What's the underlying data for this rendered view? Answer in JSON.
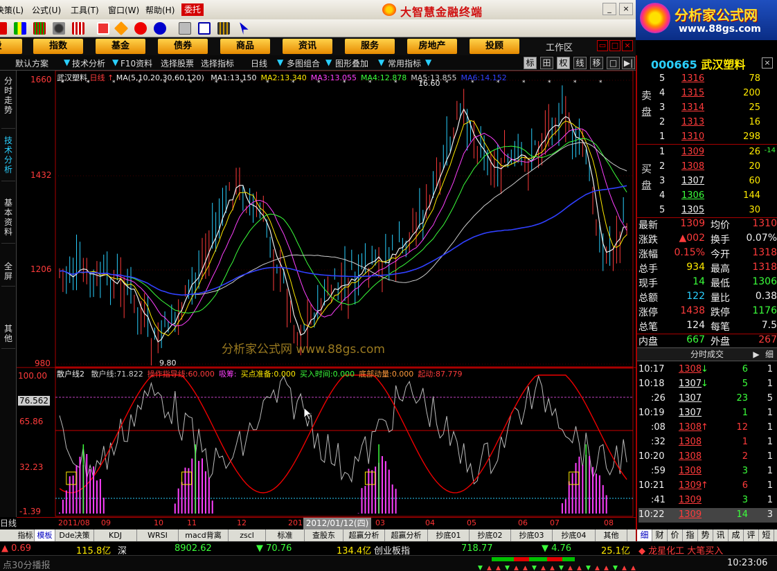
{
  "menu": {
    "items": [
      "决策(L)",
      "公式(U)",
      "工具(T)",
      "窗口(W)",
      "帮助(H)"
    ],
    "alert_button": "委托",
    "brand": "大智慧金融终端"
  },
  "logo": {
    "title": "分析家公式网",
    "url": "www.88gs.com"
  },
  "nav": {
    "items": [
      "股",
      "指数",
      "基金",
      "债券",
      "商品",
      "资讯",
      "服务",
      "房地产",
      "投顾"
    ],
    "workarea": "工作区"
  },
  "chartbar": {
    "items": [
      "默认方案",
      "技术分析",
      "F10资料",
      "选择股票",
      "选择指标",
      "日线",
      "多图组合",
      "图形叠加",
      "常用指标"
    ],
    "right_buttons": [
      "标",
      "田",
      "权",
      "线",
      "移",
      "□",
      "▶|"
    ]
  },
  "vtabs": [
    "分时走势",
    "技术分析",
    "基本资料",
    "全屏",
    "其他"
  ],
  "main_chart": {
    "stock_name": "武汉塑料",
    "period": "日线",
    "ma_params": "MA(5,10,20,30,60,120)",
    "ma_values": [
      {
        "label": "MA1:",
        "value": "13.150",
        "color": "#f0f0f0"
      },
      {
        "label": "MA2:",
        "value": "13.340",
        "color": "#ffea00"
      },
      {
        "label": "MA3:",
        "value": "13.055",
        "color": "#ff40ff"
      },
      {
        "label": "MA4:",
        "value": "12.878",
        "color": "#3bff3b"
      },
      {
        "label": "MA5:",
        "value": "13.855",
        "color": "#cfcfcf"
      },
      {
        "label": "MA6:",
        "value": "14.152",
        "color": "#3040ff"
      }
    ],
    "y_ticks": [
      "1660",
      "1432",
      "1206",
      "980"
    ],
    "high_label": "16.60",
    "low_label": "9.80",
    "watermark": "分析家公式网  www.88gs.com"
  },
  "sub_chart": {
    "title": "散户线2",
    "values": [
      {
        "label": "散户线:",
        "value": "71.822",
        "color": "#cfcfcf"
      },
      {
        "label": "操作指导线:",
        "value": "60.000",
        "color": "#ff3b3b"
      },
      {
        "label": "吸筹:",
        "value": "",
        "color": "#ff40ff"
      },
      {
        "label": "买点准备:",
        "value": "0.000",
        "color": "#ffea00"
      },
      {
        "label": "买入时间:",
        "value": "0.000",
        "color": "#3bff3b"
      },
      {
        "label": "底部动量:",
        "value": "0.000",
        "color": "#ff9a3b"
      },
      {
        "label": "起动:",
        "value": "87.779",
        "color": "#ff3b3b"
      }
    ],
    "y_ticks": [
      "100.00",
      "76.562",
      "65.86",
      "32.23",
      "-1.39"
    ]
  },
  "time_axis": {
    "day_label": "日线",
    "labels": [
      "2011/08",
      "09",
      "10",
      "11",
      "12",
      "201",
      "03",
      "04",
      "05",
      "06",
      "07",
      "08"
    ],
    "selected": "2012/01/12(四)"
  },
  "bottom_tabs": [
    "指标",
    "模板",
    "Dde决策",
    "KDJ",
    "WRSI",
    "macd背离",
    "zscl",
    "标准",
    "查股东",
    "超赢分析",
    "超赢分析",
    "抄底01",
    "抄底02",
    "抄底03",
    "抄底04",
    "其他"
  ],
  "status": {
    "items": [
      {
        "text": "▲ 0.69",
        "color": "#ff3b3b"
      },
      {
        "text": "115.8亿",
        "color": "#ffea00"
      },
      {
        "text": "深",
        "color": "#f0f0f0"
      },
      {
        "text": "8902.62",
        "color": "#3bff3b"
      },
      {
        "text": "▼ 70.76",
        "color": "#3bff3b"
      },
      {
        "text": "134.4亿",
        "color": "#ffea00"
      },
      {
        "text": "创业板指",
        "color": "#f0f0f0"
      },
      {
        "text": "718.77",
        "color": "#3bff3b"
      },
      {
        "text": "▼ 4.76",
        "color": "#3bff3b"
      },
      {
        "text": "25.1亿",
        "color": "#ffea00"
      },
      {
        "text": "◆ 龙星化工  大笔买入",
        "color": "#ff3b3b"
      }
    ],
    "ticker": "点30分播报",
    "time": "10:23:06"
  },
  "quote": {
    "code": "000665",
    "name": "武汉塑料",
    "sell_label": "卖盘",
    "buy_label": "买盘",
    "asks": [
      {
        "level": "5",
        "price": "1316",
        "vol": "78"
      },
      {
        "level": "4",
        "price": "1315",
        "vol": "200"
      },
      {
        "level": "3",
        "price": "1314",
        "vol": "25"
      },
      {
        "level": "2",
        "price": "1313",
        "vol": "16"
      },
      {
        "level": "1",
        "price": "1310",
        "vol": "298"
      }
    ],
    "bids": [
      {
        "level": "1",
        "price": "1309",
        "vol": "26",
        "extra": "-14"
      },
      {
        "level": "2",
        "price": "1308",
        "vol": "20",
        "extra": ""
      },
      {
        "level": "3",
        "price": "1307",
        "vol": "60",
        "extra": ""
      },
      {
        "level": "4",
        "price": "1306",
        "vol": "144",
        "extra": ""
      },
      {
        "level": "5",
        "price": "1305",
        "vol": "30",
        "extra": ""
      }
    ],
    "stats": [
      {
        "l1": "最新",
        "v1": "1309",
        "c1": "#ff3b3b",
        "l2": "均价",
        "v2": "1310",
        "c2": "#ff3b3b"
      },
      {
        "l1": "涨跌",
        "v1": "▲002",
        "c1": "#ff3b3b",
        "l2": "换手",
        "v2": "0.07%",
        "c2": "#f0f0f0"
      },
      {
        "l1": "涨幅",
        "v1": "0.15%",
        "c1": "#ff3b3b",
        "l2": "今开",
        "v2": "1318",
        "c2": "#ff3b3b"
      },
      {
        "l1": "总手",
        "v1": "934",
        "c1": "#ffea00",
        "l2": "最高",
        "v2": "1318",
        "c2": "#ff3b3b"
      },
      {
        "l1": "现手",
        "v1": "14",
        "c1": "#3bff3b",
        "l2": "最低",
        "v2": "1306",
        "c2": "#3bff3b"
      },
      {
        "l1": "总额",
        "v1": "122",
        "c1": "#2ad0ff",
        "l2": "量比",
        "v2": "0.38",
        "c2": "#f0f0f0"
      },
      {
        "l1": "涨停",
        "v1": "1438",
        "c1": "#ff3b3b",
        "l2": "跌停",
        "v2": "1176",
        "c2": "#3bff3b"
      },
      {
        "l1": "总笔",
        "v1": "124",
        "c1": "#f0f0f0",
        "l2": "每笔",
        "v2": "7.5",
        "c2": "#f0f0f0"
      },
      {
        "l1": "内盘",
        "v1": "667",
        "c1": "#3bff3b",
        "l2": "外盘",
        "v2": "267",
        "c2": "#ff3b3b"
      }
    ],
    "trades_title": "分时成交",
    "trades_btn": "细",
    "trades": [
      {
        "time": "10:17",
        "price": "1308",
        "arrow": "↓",
        "arrow_color": "#3bff3b",
        "vol": "6",
        "vol_color": "#3bff3b",
        "n": "1"
      },
      {
        "time": "10:18",
        "price": "1307",
        "arrow": "↓",
        "arrow_color": "#3bff3b",
        "vol": "5",
        "vol_color": "#3bff3b",
        "n": "1"
      },
      {
        "time": ":26",
        "price": "1307",
        "arrow": "",
        "arrow_color": "",
        "vol": "23",
        "vol_color": "#3bff3b",
        "n": "5"
      },
      {
        "time": "10:19",
        "price": "1307",
        "arrow": "",
        "arrow_color": "",
        "vol": "1",
        "vol_color": "#3bff3b",
        "n": "1"
      },
      {
        "time": ":08",
        "price": "1308",
        "arrow": "↑",
        "arrow_color": "#ff3b3b",
        "vol": "12",
        "vol_color": "#ff3b3b",
        "n": "1"
      },
      {
        "time": ":32",
        "price": "1308",
        "arrow": "",
        "arrow_color": "",
        "vol": "1",
        "vol_color": "#ff3b3b",
        "n": "1"
      },
      {
        "time": "10:20",
        "price": "1308",
        "arrow": "",
        "arrow_color": "",
        "vol": "2",
        "vol_color": "#ff3b3b",
        "n": "1"
      },
      {
        "time": ":59",
        "price": "1308",
        "arrow": "",
        "arrow_color": "",
        "vol": "3",
        "vol_color": "#3bff3b",
        "n": "1"
      },
      {
        "time": "10:21",
        "price": "1309",
        "arrow": "↑",
        "arrow_color": "#ff3b3b",
        "vol": "6",
        "vol_color": "#ff3b3b",
        "n": "1"
      },
      {
        "time": ":41",
        "price": "1309",
        "arrow": "",
        "arrow_color": "",
        "vol": "3",
        "vol_color": "#3bff3b",
        "n": "1"
      },
      {
        "time": "10:22",
        "price": "1309",
        "arrow": "",
        "arrow_color": "",
        "vol": "14",
        "vol_color": "#3bff3b",
        "n": "3"
      }
    ],
    "right_tabs": [
      "细",
      "财",
      "价",
      "指",
      "势",
      "讯",
      "成",
      "评",
      "短"
    ]
  },
  "colors": {
    "up": "#ff3b3b",
    "down": "#3bff3b",
    "bg": "#000000",
    "accent": "#ffea00",
    "frame": "#aa0000"
  }
}
